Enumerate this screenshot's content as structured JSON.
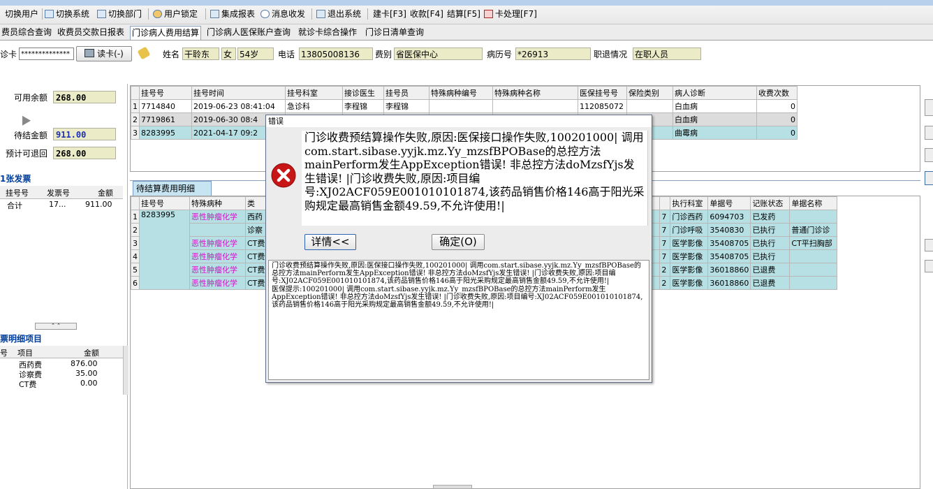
{
  "toolbar": {
    "items": [
      "切换用户",
      "切换系统",
      "切换部门",
      "用户锁定",
      "集成报表",
      "消息收发",
      "退出系统",
      "建卡[F3]",
      "收款[F4]",
      "结算[F5]",
      "卡处理[F7]"
    ]
  },
  "tabs": [
    "费员综合查询",
    "收费员交款日报表",
    "门诊病人费用结算",
    "门诊病人医保账户查询",
    "就诊卡综合操作",
    "门诊日清单查询"
  ],
  "active_tab": "门诊病人费用结算",
  "patient": {
    "card_label": "诊卡",
    "card_value": "**************",
    "read_card_button": "读卡(-)",
    "name_label": "姓名",
    "name": "干聆东",
    "sex": "女",
    "age": "54岁",
    "phone_label": "电话",
    "phone": "13805008136",
    "fee_type_label": "费别",
    "fee_type": "省医保中心",
    "record_label": "病历号",
    "record_no": "*26913",
    "job_label": "职退情况",
    "job_status": "在职人员"
  },
  "balance": {
    "available_label": "可用余额",
    "available": "268.00",
    "pending_label": "待结金额",
    "pending": "911.00",
    "refund_label": "预计可退回",
    "refund": "268.00"
  },
  "invoice": {
    "title": "1张发票",
    "headers": [
      "挂号号",
      "发票号",
      "金额"
    ],
    "total_row": [
      "合计",
      "17...",
      "911.00"
    ],
    "detail_title": "票明细项目",
    "detail_headers": [
      "号",
      "项目",
      "金额"
    ],
    "detail_rows": [
      [
        "",
        "西药费",
        "876.00"
      ],
      [
        "",
        "诊察费",
        "35.00"
      ],
      [
        "",
        "CT费",
        "0.00"
      ]
    ]
  },
  "registration_grid": {
    "headers": [
      "挂号号",
      "挂号时间",
      "挂号科室",
      "接诊医生",
      "挂号员",
      "特殊病种编号",
      "特殊病种名称",
      "医保挂号号",
      "保险类别",
      "病人诊断",
      "收费次数"
    ],
    "rows": [
      [
        "1",
        "7714840",
        "2019-06-23 08:41:04",
        "急诊科",
        "李程锦",
        "李程锦",
        "",
        "",
        "112085072",
        "",
        "白血病",
        "0"
      ],
      [
        "2",
        "7719861",
        "2019-06-30 08:4",
        "",
        "",
        "",
        "",
        "",
        "",
        "",
        "白血病",
        "0"
      ],
      [
        "3",
        "8283995",
        "2021-04-17 09:2",
        "",
        "",
        "",
        "",
        "",
        "",
        "",
        "曲霉病",
        "0"
      ]
    ]
  },
  "pending_tab": "待结算费用明细",
  "fee_grid": {
    "headers": [
      "挂号号",
      "特殊病种",
      "类",
      "执行科室",
      "单据号",
      "记账状态",
      "单据名称"
    ],
    "reg_no": "8283995",
    "rows": [
      [
        "1",
        "恶性肿瘤化学",
        "西药",
        "7",
        "门诊西药",
        "6094703",
        "已发药",
        ""
      ],
      [
        "2",
        "",
        "诊察",
        "7",
        "门诊呼吸",
        "3540830",
        "已执行",
        "普通门诊诊"
      ],
      [
        "3",
        "恶性肿瘤化学",
        "CT费",
        "7",
        "医学影像",
        "35408705",
        "已执行",
        "CT平扫胸部"
      ],
      [
        "4",
        "恶性肿瘤化学",
        "CT费",
        "7",
        "医学影像",
        "35408705",
        "已执行",
        ""
      ],
      [
        "5",
        "恶性肿瘤化学",
        "CT费",
        "2",
        "医学影像",
        "36018860",
        "已退费",
        ""
      ],
      [
        "6",
        "恶性肿瘤化学",
        "CT费",
        "2",
        "医学影像",
        "36018860",
        "已退费",
        ""
      ]
    ]
  },
  "dialog": {
    "title": "错误",
    "message": "门诊收费预结算操作失败,原因:医保接口操作失败,100201000| 调用com.start.sibase.yyjk.mz.Yy_mzsfBPOBase的总控方法mainPerform发生AppException错误! 非总控方法doMzsfYjs发生错误! |门诊收费失败,原因:项目编号:XJ02ACF059E001010101874,该药品销售价格146高于阳光采购规定最高销售金额49.59,不允许使用!|",
    "details_button": "详情<<",
    "ok_button": "确定(O)",
    "detail_text": "门诊收费预结算操作失败,原因:医保接口操作失败,100201000| 调用com.start.sibase.yyjk.mz.Yy_mzsfBPOBase的总控方法mainPerform发生AppException错误! 非总控方法doMzsfYjs发生错误! |门诊收费失败,原因:项目编号:XJ02ACF059E001010101874,该药品销售价格146高于阳光采购规定最高销售金额49.59,不允许使用!|\n医保提示:100201000| 调用com.start.sibase.yyjk.mz.Yy_mzsfBPOBase的总控方法mainPerform发生AppException错误! 非总控方法doMzsfYjs发生错误! |门诊收费失败,原因:项目编号:XJ02ACF059E001010101874,该药品销售价格146高于阳光采购规定最高销售金额49.59,不允许使用!|"
  }
}
